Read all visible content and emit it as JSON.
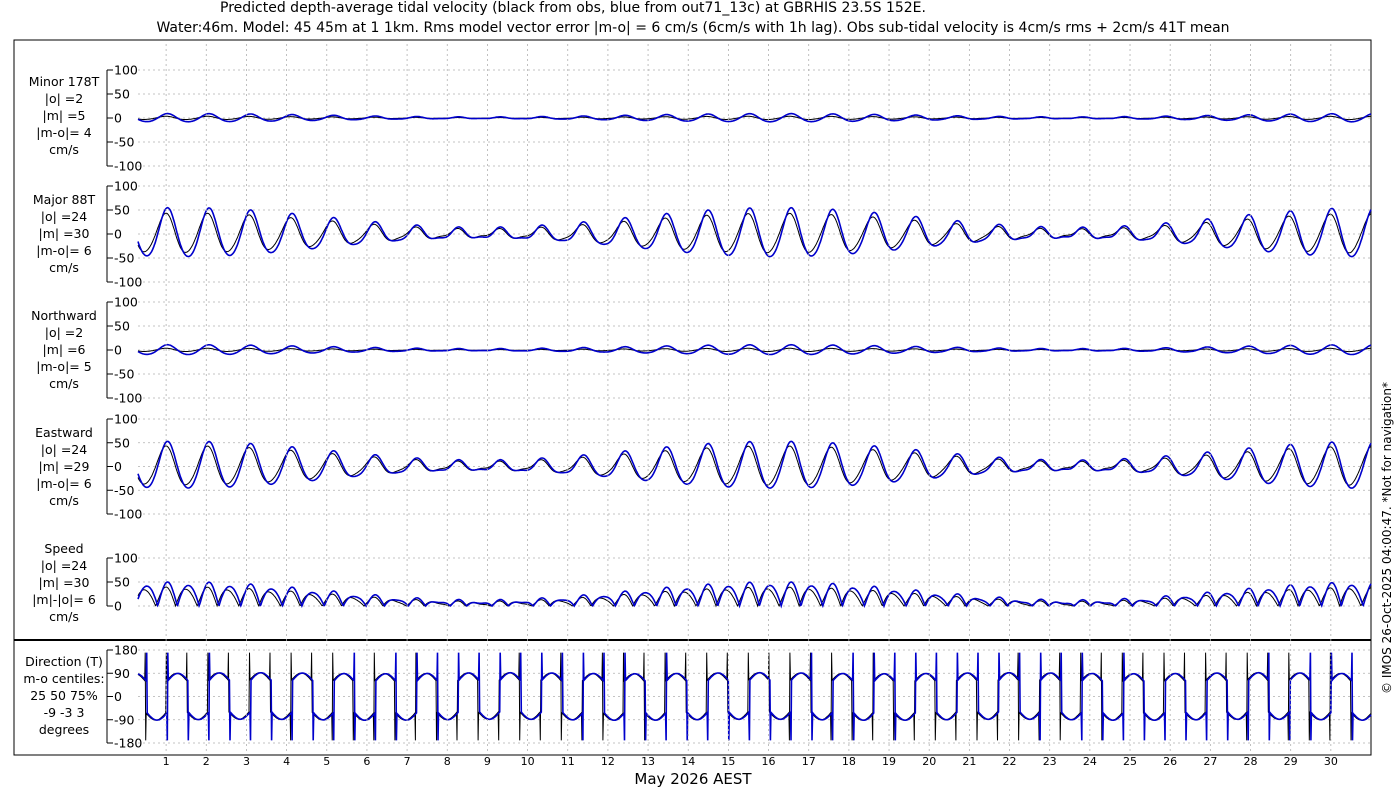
{
  "header": {
    "title_line1": "Predicted depth-average tidal velocity (black from obs, blue from out71_13c) at GBRHIS 23.5S 152E.",
    "title_line2": "Water:46m. Model: 45 45m at 1 1km. Rms model vector error |m-o| = 6 cm/s (6cm/s with 1h lag). Obs sub-tidal velocity is 4cm/s rms + 2cm/s 41T mean"
  },
  "footer": {
    "xlabel": "May 2026 AEST",
    "watermark": "© IMOS 26-Oct-2025 04:00:47. *Not for navigation*"
  },
  "colors": {
    "obs": "#000000",
    "model": "#0000cc",
    "grid": "#b0b0b0"
  },
  "chart_data": {
    "type": "line",
    "x_ticks": [
      "1",
      "2",
      "3",
      "4",
      "5",
      "6",
      "7",
      "8",
      "9",
      "10",
      "11",
      "12",
      "13",
      "14",
      "15",
      "16",
      "17",
      "18",
      "19",
      "20",
      "21",
      "22",
      "23",
      "24",
      "25",
      "26",
      "27",
      "28",
      "29",
      "30"
    ],
    "x_range_days": [
      0.3,
      31.0
    ],
    "grid": true,
    "panels": [
      {
        "id": "minor",
        "label_lines": [
          "Minor 178T",
          "|o| =2",
          "|m| =5",
          "|m-o|= 4",
          "cm/s"
        ],
        "ylim": [
          -100,
          100
        ],
        "yticks": [
          "100",
          "50",
          "0",
          "-50",
          "-100"
        ],
        "model_series": {
          "name": "out71_13c",
          "amplitude": 5
        },
        "obs_series": {
          "name": "obs",
          "amplitude": 2
        }
      },
      {
        "id": "major",
        "label_lines": [
          "Major 88T",
          "|o| =24",
          "|m| =30",
          "|m-o|= 6",
          "cm/s"
        ],
        "ylim": [
          -100,
          100
        ],
        "yticks": [
          "100",
          "50",
          "0",
          "-50",
          "-100"
        ],
        "model_series": {
          "name": "out71_13c",
          "amplitude": 30
        },
        "obs_series": {
          "name": "obs",
          "amplitude": 24
        }
      },
      {
        "id": "northward",
        "label_lines": [
          "Northward",
          "|o| =2",
          "|m| =6",
          "|m-o|= 5",
          "cm/s"
        ],
        "ylim": [
          -100,
          100
        ],
        "yticks": [
          "100",
          "50",
          "0",
          "-50",
          "-100"
        ],
        "model_series": {
          "name": "out71_13c",
          "amplitude": 6
        },
        "obs_series": {
          "name": "obs",
          "amplitude": 2
        }
      },
      {
        "id": "eastward",
        "label_lines": [
          "Eastward",
          "|o| =24",
          "|m| =29",
          "|m-o|= 6",
          "cm/s"
        ],
        "ylim": [
          -100,
          100
        ],
        "yticks": [
          "100",
          "50",
          "0",
          "-50",
          "-100"
        ],
        "model_series": {
          "name": "out71_13c",
          "amplitude": 29
        },
        "obs_series": {
          "name": "obs",
          "amplitude": 24
        }
      },
      {
        "id": "speed",
        "label_lines": [
          "Speed",
          "|o| =24",
          "|m| =30",
          "|m|-|o|= 6",
          "cm/s"
        ],
        "ylim": [
          0,
          100
        ],
        "yticks": [
          "100",
          "50",
          "0"
        ],
        "model_series": {
          "name": "out71_13c",
          "amplitude": 30
        },
        "obs_series": {
          "name": "obs",
          "amplitude": 24
        }
      },
      {
        "id": "direction",
        "label_lines": [
          "Direction (T)",
          "m-o centiles:",
          "25  50  75%",
          "-9 -3  3",
          "degrees"
        ],
        "ylim": [
          -180,
          180
        ],
        "yticks": [
          "180",
          "90",
          "0",
          "-90",
          "-180"
        ],
        "model_series": {
          "name": "out71_13c",
          "amplitude": 90
        },
        "obs_series": {
          "name": "obs",
          "amplitude": 90
        }
      }
    ]
  }
}
